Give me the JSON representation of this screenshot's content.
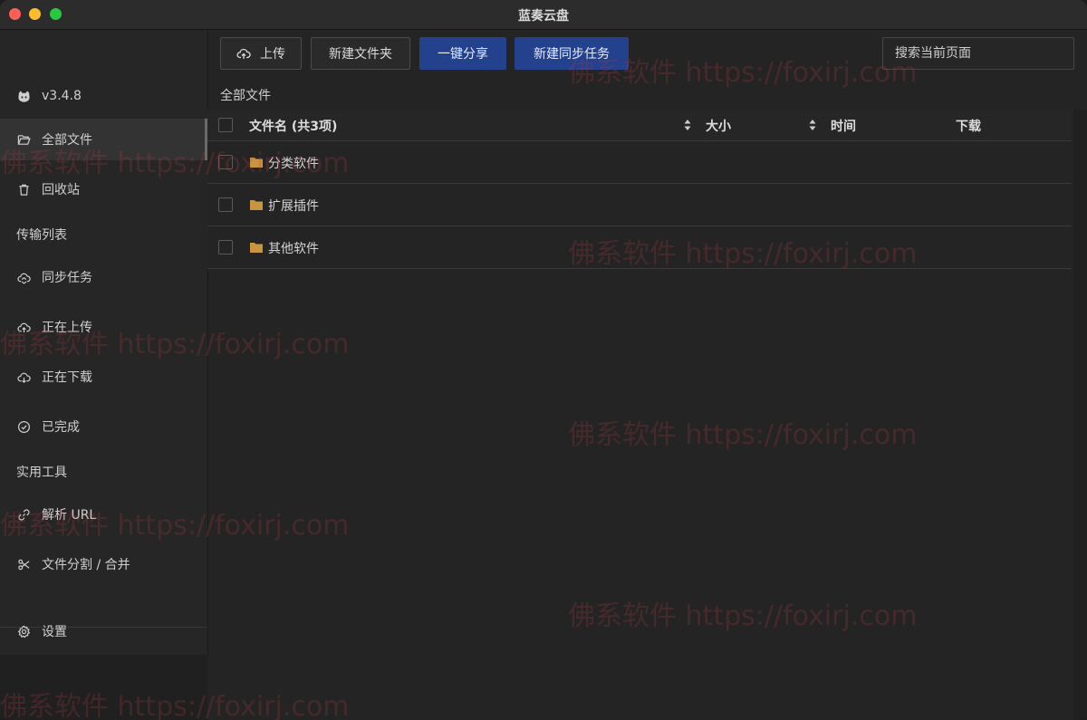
{
  "window": {
    "title": "蓝奏云盘"
  },
  "sidebar": {
    "version": "v3.4.8",
    "items": [
      {
        "label": "全部文件",
        "icon": "folder-open-icon",
        "active": true
      },
      {
        "label": "回收站",
        "icon": "trash-icon"
      }
    ],
    "transfer_heading": "传输列表",
    "transfer_items": [
      {
        "label": "同步任务",
        "icon": "cloud-sync-icon"
      },
      {
        "label": "正在上传",
        "icon": "cloud-upload-icon"
      },
      {
        "label": "正在下载",
        "icon": "cloud-download-icon"
      },
      {
        "label": "已完成",
        "icon": "check-circle-icon"
      }
    ],
    "tools_heading": "实用工具",
    "tool_items": [
      {
        "label": "解析 URL",
        "icon": "link-icon"
      },
      {
        "label": "文件分割 / 合并",
        "icon": "scissors-icon"
      }
    ],
    "settings_label": "设置"
  },
  "toolbar": {
    "upload_label": "上传",
    "new_folder_label": "新建文件夹",
    "share_label": "一键分享",
    "sync_task_label": "新建同步任务",
    "search_placeholder": "搜索当前页面"
  },
  "breadcrumb": "全部文件",
  "table": {
    "columns": {
      "name": "文件名 (共3项)",
      "size": "大小",
      "time": "时间",
      "download": "下载"
    },
    "rows": [
      {
        "name": "分类软件"
      },
      {
        "name": "扩展插件"
      },
      {
        "name": "其他软件"
      }
    ]
  },
  "watermark": "佛系软件 https://foxirj.com",
  "colors": {
    "primary": "#23418c",
    "folder": "#c9953f",
    "background": "#242424"
  }
}
